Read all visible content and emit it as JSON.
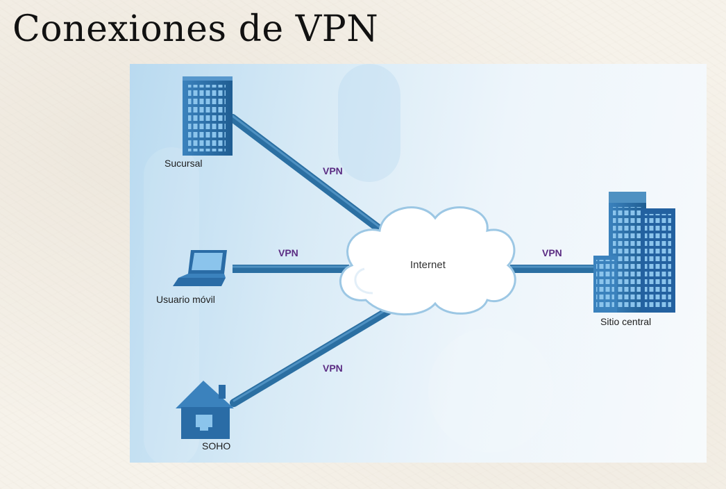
{
  "slide": {
    "title": "Conexiones de VPN"
  },
  "diagram": {
    "cloud_label": "Internet",
    "link_label": "VPN",
    "nodes": {
      "branch": "Sucursal",
      "mobile": "Usuario móvil",
      "soho": "SOHO",
      "central": "Sitio central"
    }
  },
  "colors": {
    "link": "#2b6fa2",
    "link_highlight": "#4f91c2",
    "vpn_text": "#5b2c83",
    "building": "#2a6ca6",
    "building_window": "#8bc4ec",
    "panel_left": "#b9daf0",
    "panel_right": "#f7fafc"
  }
}
